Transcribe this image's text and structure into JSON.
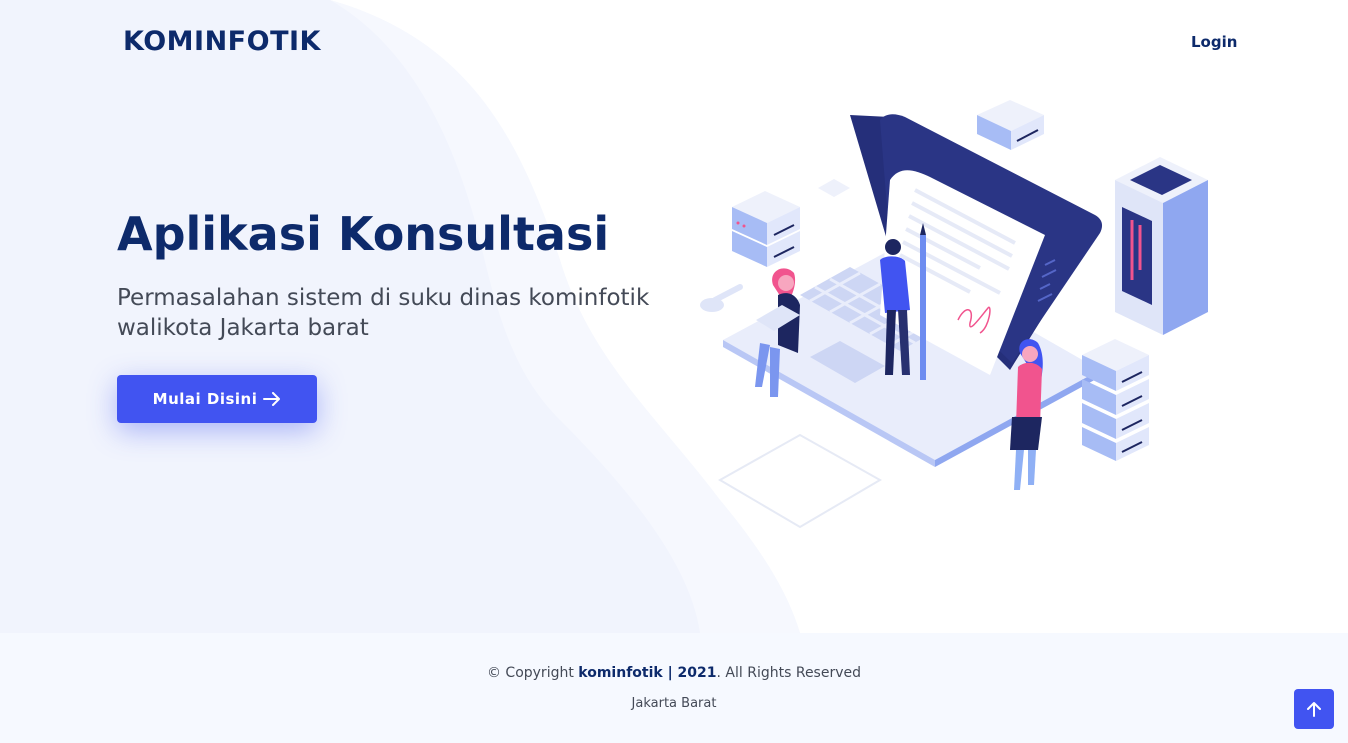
{
  "header": {
    "logo_text": "KOMINFOTIK",
    "login_label": "Login"
  },
  "hero": {
    "title": "Aplikasi Konsultasi",
    "subtitle": "Permasalahan sistem di suku dinas kominfotik walikota Jakarta barat",
    "cta_label": "Mulai Disini",
    "cta_icon": "arrow-right-icon"
  },
  "footer": {
    "copyright_prefix": "© Copyright ",
    "copyright_brand": "kominfotik | 2021",
    "copyright_suffix": ". All Rights Reserved",
    "city": "Jakarta Barat"
  },
  "back_to_top": {
    "icon": "arrow-up-icon"
  },
  "colors": {
    "primary": "#4154f1",
    "navy": "#0d2a6b",
    "text": "#444a57",
    "hero_bg": "#f1f4fd",
    "footer_bg": "#f6f9ff",
    "accent_pink": "#f1548e"
  }
}
